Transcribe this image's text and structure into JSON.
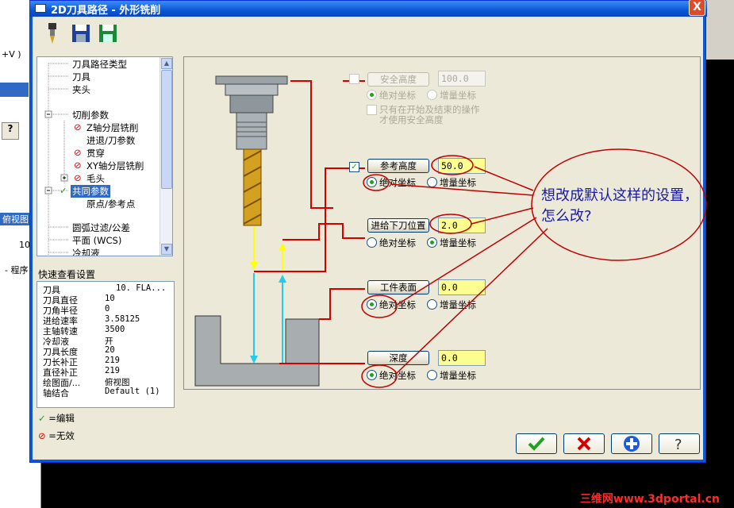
{
  "dialog": {
    "title": "2D刀具路径 - 外形铣削",
    "close": "X"
  },
  "background": {
    "texts": [
      "+V )",
      "俯视图",
      "10",
      "- 程序"
    ]
  },
  "tree": {
    "items": [
      {
        "label": "刀具路径类型",
        "status": ""
      },
      {
        "label": "刀具",
        "status": ""
      },
      {
        "label": "夹头",
        "status": ""
      },
      {
        "label": "切削参数",
        "status": "expanded"
      },
      {
        "label": "Z轴分层铣削",
        "status": "disabled"
      },
      {
        "label": "进退/刀参数",
        "status": ""
      },
      {
        "label": "贯穿",
        "status": "disabled"
      },
      {
        "label": "XY轴分层铣削",
        "status": "disabled"
      },
      {
        "label": "毛头",
        "status": "disabled"
      },
      {
        "label": "共同参数",
        "status": "edited"
      },
      {
        "label": "原点/参考点",
        "status": ""
      },
      {
        "label": "圆弧过滤/公差",
        "status": ""
      },
      {
        "label": "平面 (WCS)",
        "status": ""
      },
      {
        "label": "冷却液",
        "status": ""
      }
    ]
  },
  "quickview": {
    "title": "快速查看设置",
    "rows": [
      {
        "k": "刀具",
        "v": "10. FLA..."
      },
      {
        "k": "刀具直径",
        "v": "10"
      },
      {
        "k": "刀角半径",
        "v": "0"
      },
      {
        "k": "进给速率",
        "v": "3.58125"
      },
      {
        "k": "主轴转速",
        "v": "3500"
      },
      {
        "k": "冷却液",
        "v": "开"
      },
      {
        "k": "刀具长度",
        "v": "20"
      },
      {
        "k": "刀长补正",
        "v": "219"
      },
      {
        "k": "直径补正",
        "v": "219"
      },
      {
        "k": "绘图面/...",
        "v": "俯视图"
      },
      {
        "k": "轴结合",
        "v": "Default (1)"
      }
    ]
  },
  "legend": {
    "edit": "=编辑",
    "invalid": "=无效"
  },
  "params": {
    "safety": {
      "label": "安全高度",
      "value": "100.0",
      "abs": "绝对坐标",
      "inc": "增量坐标",
      "only": "只有在开始及结束的操作",
      "only2": "才使用安全高度"
    },
    "reference": {
      "label": "参考高度",
      "value": "50.0",
      "abs": "绝对坐标",
      "inc": "增量坐标"
    },
    "feed": {
      "label": "进给下刀位置",
      "value": "2.0",
      "abs": "绝对坐标",
      "inc": "增量坐标"
    },
    "top": {
      "label": "工件表面",
      "value": "0.0",
      "abs": "绝对坐标",
      "inc": "增量坐标"
    },
    "depth": {
      "label": "深度",
      "value": "0.0",
      "abs": "绝对坐标",
      "inc": "增量坐标"
    }
  },
  "annotation": {
    "text": "想改成默认这样的设置，怎么改?"
  },
  "watermark": "三维网www.3dportal.cn",
  "colors": {
    "annotation_red": "#c00000",
    "tool_gold": "#d4a020",
    "arrow_yellow": "#ffff00",
    "arrow_cyan": "#22ccee"
  }
}
